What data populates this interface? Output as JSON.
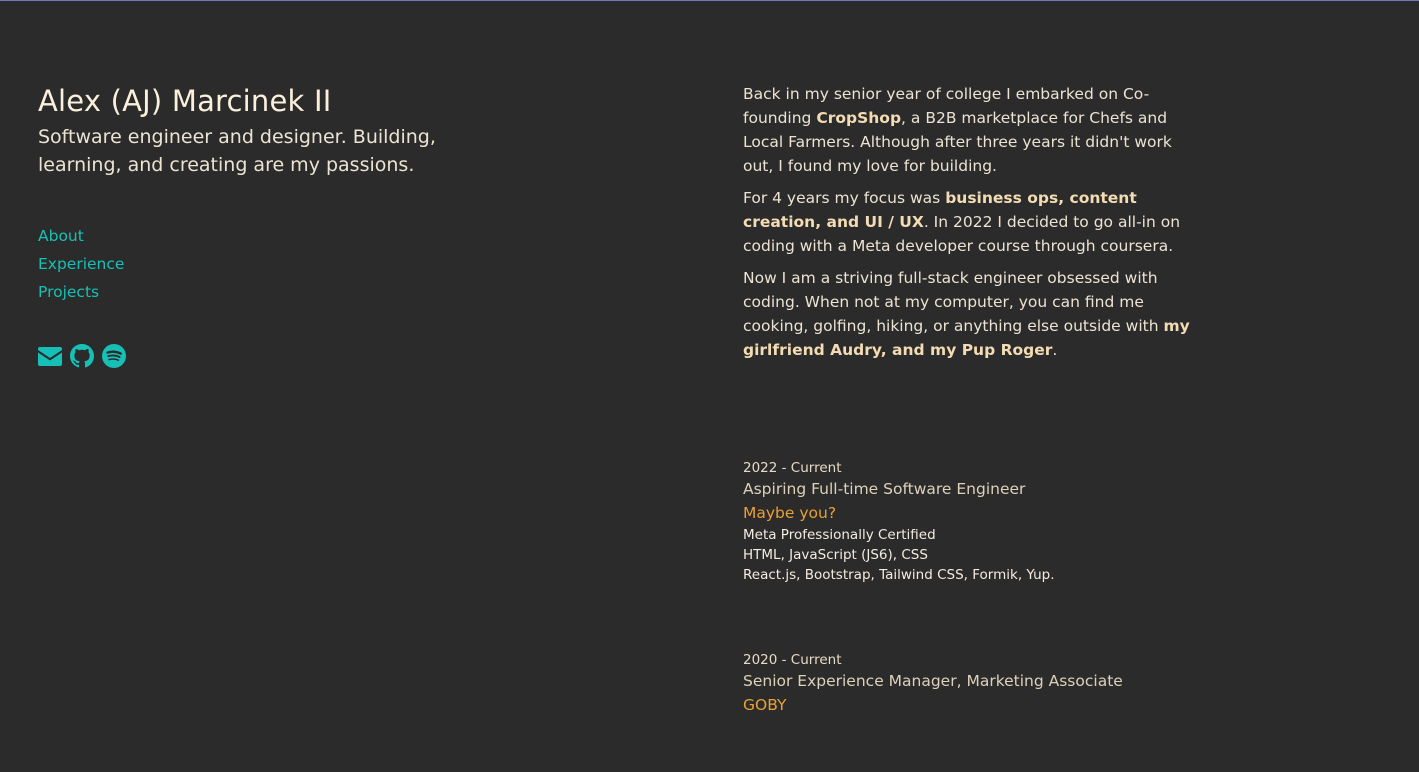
{
  "header": {
    "name": "Alex (AJ) Marcinek II",
    "tagline": "Software engineer and designer. Building, learning, and creating are my passions."
  },
  "nav": {
    "about": "About",
    "experience": "Experience",
    "projects": "Projects"
  },
  "socials": {
    "email_icon": "envelope-icon",
    "github_icon": "github-icon",
    "spotify_icon": "spotify-icon"
  },
  "about": {
    "p1_a": "Back in my senior year of college I embarked on Co-founding ",
    "p1_link": "CropShop",
    "p1_b": ", a B2B marketplace for Chefs and Local Farmers. Although after three years it didn't work out, I found my love for building.",
    "p2_a": "For 4 years my focus was ",
    "p2_link": "business ops, content creation, and UI / UX",
    "p2_b": ". In 2022 I decided to go all-in on coding with a Meta developer course through coursera.",
    "p3_a": "Now I am a striving full-stack engineer obsessed with coding. When not at my computer, you can find me cooking, golfing, hiking, or anything else outside with ",
    "p3_link": "my girlfriend Audry, and my Pup Roger",
    "p3_b": "."
  },
  "experience": [
    {
      "date": "2022 - Current",
      "title": "Aspiring Full-time Software Engineer",
      "company": "Maybe you?",
      "details": [
        "Meta Professionally Certified",
        "HTML, JavaScript (JS6), CSS",
        "React.js, Bootstrap, Tailwind CSS, Formik, Yup."
      ]
    },
    {
      "date": "2020 - Current",
      "title": "Senior Experience Manager, Marketing Associate",
      "company": "GOBY"
    }
  ],
  "colors": {
    "background": "#2b2b2b",
    "accent": "#17c0b6",
    "highlight": "#f3dcb3",
    "company": "#e8a133"
  }
}
